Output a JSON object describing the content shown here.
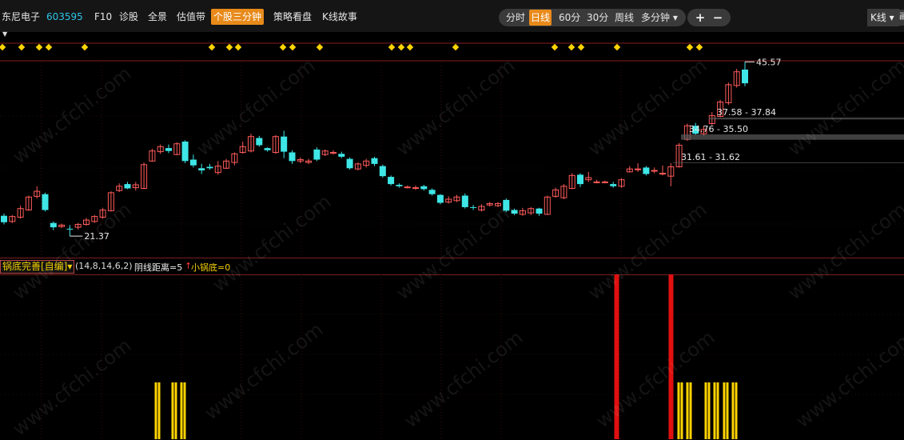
{
  "header": {
    "stock_name": "东尼电子",
    "stock_code": "603595",
    "nav": [
      "F10",
      "诊股",
      "全景",
      "估值带",
      "个股三分钟",
      "策略看盘",
      "K线故事"
    ],
    "nav_active": 4,
    "periods": [
      "分时",
      "日线",
      "60分",
      "30分",
      "周线",
      "多分钟 ▾"
    ],
    "period_active": 1,
    "zoom_in": "+",
    "zoom_out": "−",
    "kline_select": "K线 ▾",
    "edge_label": "画"
  },
  "indicator": {
    "selector": "锅底完善[自编]▾",
    "params": "(14,8,14,6,2)",
    "yin": "阴线距离=5",
    "arrow": "↑",
    "guodi": "小锅底=0"
  },
  "watermark": "www.cfchi.com",
  "colors": {
    "up": "#ff5a5a",
    "down": "#3ee6e6",
    "gold": "#ffd400",
    "signal_red": "#e01010"
  },
  "chart_data": {
    "type": "candlestick",
    "ylim": [
      19.5,
      47.5
    ],
    "annotations": {
      "high": "45.57",
      "low": "21.37",
      "gap1": "37.58 - 37.84",
      "gap2": "34.76 - 35.50",
      "gap3": "31.61 - 31.62"
    },
    "candles": [
      [
        24.2,
        23.3,
        24.5,
        23.0
      ],
      [
        23.4,
        24.1,
        24.3,
        23.2
      ],
      [
        24.0,
        25.2,
        25.6,
        23.8
      ],
      [
        25.0,
        26.8,
        27.0,
        24.9
      ],
      [
        26.9,
        27.6,
        28.3,
        26.6
      ],
      [
        27.2,
        25.0,
        27.4,
        24.8
      ],
      [
        23.2,
        22.6,
        23.4,
        22.2
      ],
      [
        22.7,
        22.9,
        23.1,
        22.5
      ],
      [
        22.4,
        22.3,
        22.9,
        21.37
      ],
      [
        22.6,
        23.0,
        23.2,
        22.3
      ],
      [
        23.0,
        23.6,
        23.9,
        22.8
      ],
      [
        23.4,
        24.1,
        24.3,
        23.2
      ],
      [
        24.0,
        25.0,
        25.3,
        23.8
      ],
      [
        24.9,
        27.4,
        27.6,
        24.8
      ],
      [
        27.7,
        28.3,
        28.7,
        27.5
      ],
      [
        28.6,
        28.0,
        28.9,
        27.9
      ],
      [
        28.1,
        28.5,
        28.9,
        27.7
      ],
      [
        28.0,
        31.3,
        31.6,
        27.9
      ],
      [
        31.8,
        33.2,
        33.5,
        31.7
      ],
      [
        33.1,
        33.8,
        34.1,
        32.8
      ],
      [
        33.6,
        33.2,
        34.1,
        32.9
      ],
      [
        32.7,
        34.2,
        34.4,
        32.6
      ],
      [
        34.5,
        31.8,
        34.7,
        31.5
      ],
      [
        32.0,
        31.2,
        32.7,
        30.9
      ],
      [
        30.8,
        30.5,
        31.4,
        30.0
      ],
      [
        31.0,
        30.8,
        31.4,
        30.6
      ],
      [
        30.2,
        31.1,
        31.8,
        29.9
      ],
      [
        30.8,
        31.8,
        32.1,
        30.7
      ],
      [
        31.6,
        32.8,
        33.0,
        31.2
      ],
      [
        33.0,
        33.8,
        34.5,
        32.8
      ],
      [
        33.2,
        35.2,
        35.6,
        33.0
      ],
      [
        35.0,
        34.0,
        35.3,
        33.8
      ],
      [
        33.6,
        33.3,
        33.7,
        33.1
      ],
      [
        33.0,
        35.2,
        35.4,
        32.8
      ],
      [
        35.2,
        33.1,
        36.0,
        32.2
      ],
      [
        33.0,
        31.8,
        33.3,
        31.4
      ],
      [
        31.8,
        32.0,
        32.3,
        31.5
      ],
      [
        31.6,
        31.8,
        32.1,
        31.4
      ],
      [
        33.4,
        32.0,
        33.7,
        31.8
      ],
      [
        32.7,
        33.2,
        33.4,
        32.5
      ],
      [
        33.0,
        33.0,
        33.3,
        32.7
      ],
      [
        32.8,
        32.4,
        33.1,
        32.2
      ],
      [
        32.1,
        30.8,
        32.3,
        30.6
      ],
      [
        30.7,
        31.4,
        31.6,
        30.5
      ],
      [
        31.2,
        31.8,
        32.1,
        30.9
      ],
      [
        32.2,
        31.4,
        32.4,
        31.1
      ],
      [
        31.1,
        29.7,
        31.3,
        29.5
      ],
      [
        29.6,
        28.6,
        29.8,
        28.4
      ],
      [
        28.5,
        28.3,
        28.7,
        28.1
      ],
      [
        28.2,
        28.2,
        28.4,
        28.0
      ],
      [
        28.1,
        28.1,
        28.4,
        27.8
      ],
      [
        28.3,
        27.9,
        28.5,
        27.7
      ],
      [
        27.8,
        27.2,
        28.0,
        27.0
      ],
      [
        27.1,
        26.0,
        27.2,
        25.8
      ],
      [
        26.1,
        26.5,
        26.9,
        25.9
      ],
      [
        26.3,
        26.8,
        27.1,
        26.1
      ],
      [
        27.0,
        25.4,
        27.3,
        25.2
      ],
      [
        25.4,
        25.3,
        25.7,
        25.0
      ],
      [
        25.0,
        25.5,
        25.8,
        24.8
      ],
      [
        25.7,
        25.9,
        26.1,
        25.5
      ],
      [
        25.6,
        25.9,
        26.1,
        25.4
      ],
      [
        26.4,
        24.9,
        26.6,
        24.7
      ],
      [
        25.0,
        24.5,
        25.2,
        24.3
      ],
      [
        24.4,
        24.9,
        25.3,
        24.2
      ],
      [
        24.6,
        25.2,
        25.4,
        24.3
      ],
      [
        25.2,
        24.5,
        25.3,
        24.2
      ],
      [
        24.4,
        26.8,
        27.0,
        24.3
      ],
      [
        26.9,
        27.8,
        28.1,
        26.7
      ],
      [
        26.7,
        28.3,
        28.6,
        26.5
      ],
      [
        28.0,
        29.8,
        30.1,
        27.9
      ],
      [
        29.9,
        28.6,
        30.1,
        28.2
      ],
      [
        29.2,
        29.5,
        30.3,
        28.9
      ],
      [
        28.9,
        28.9,
        29.2,
        28.7
      ],
      [
        28.9,
        28.9,
        29.1,
        28.7
      ],
      [
        28.6,
        28.3,
        28.9,
        28.1
      ],
      [
        28.3,
        29.2,
        29.4,
        28.1
      ],
      [
        30.3,
        30.7,
        31.1,
        30.2
      ],
      [
        30.6,
        30.7,
        31.5,
        30.3
      ],
      [
        30.9,
        30.0,
        31.1,
        29.8
      ],
      [
        30.5,
        30.5,
        30.9,
        30.1
      ],
      [
        30.0,
        30.1,
        31.2,
        29.8
      ],
      [
        29.7,
        31.0,
        31.5,
        28.3
      ],
      [
        31.0,
        34.0,
        34.3,
        30.9
      ],
      [
        34.8,
        36.7,
        37.0,
        34.6
      ],
      [
        36.7,
        35.6,
        37.1,
        35.4
      ],
      [
        35.6,
        36.2,
        36.7,
        35.3
      ],
      [
        37.0,
        38.1,
        38.6,
        36.8
      ],
      [
        38.0,
        40.0,
        40.3,
        37.9
      ],
      [
        39.9,
        42.4,
        42.7,
        39.6
      ],
      [
        42.3,
        44.2,
        44.6,
        42.0
      ],
      [
        44.5,
        42.6,
        45.57,
        42.2
      ]
    ],
    "indicator_bars": [
      {
        "x": 195,
        "color": "gold"
      },
      {
        "x": 199,
        "color": "gold"
      },
      {
        "x": 216,
        "color": "gold"
      },
      {
        "x": 220,
        "color": "gold"
      },
      {
        "x": 227,
        "color": "gold"
      },
      {
        "x": 231,
        "color": "gold"
      },
      {
        "x": 770,
        "color": "red"
      },
      {
        "x": 773,
        "color": "red"
      },
      {
        "x": 838,
        "color": "red"
      },
      {
        "x": 841,
        "color": "red"
      },
      {
        "x": 849,
        "color": "gold"
      },
      {
        "x": 853,
        "color": "gold"
      },
      {
        "x": 860,
        "color": "gold"
      },
      {
        "x": 864,
        "color": "gold"
      },
      {
        "x": 883,
        "color": "gold"
      },
      {
        "x": 887,
        "color": "gold"
      },
      {
        "x": 894,
        "color": "gold"
      },
      {
        "x": 898,
        "color": "gold"
      },
      {
        "x": 906,
        "color": "gold"
      },
      {
        "x": 910,
        "color": "gold"
      },
      {
        "x": 917,
        "color": "gold"
      },
      {
        "x": 921,
        "color": "gold"
      }
    ],
    "diamonds": [
      3,
      27,
      49,
      61,
      106,
      265,
      287,
      298,
      354,
      366,
      400,
      490,
      502,
      513,
      570,
      694,
      715,
      727,
      772,
      863,
      875
    ]
  }
}
